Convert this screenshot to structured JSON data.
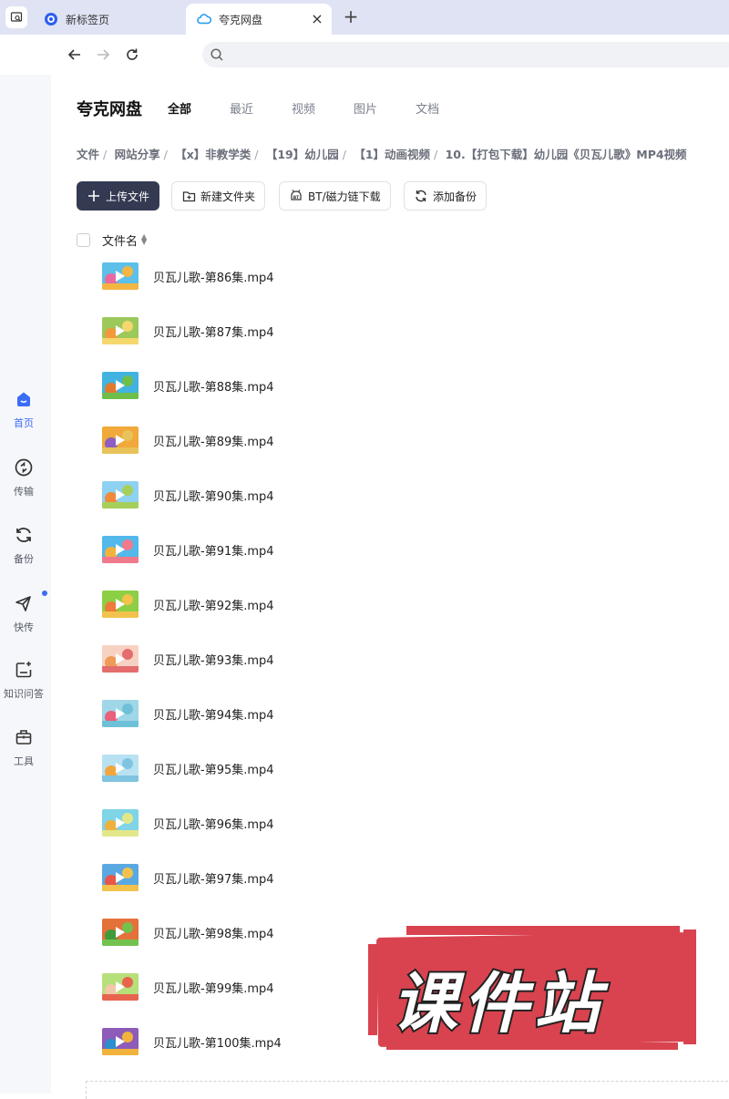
{
  "browser": {
    "tabs": [
      {
        "label": "新标签页",
        "active": false,
        "icon": "browser-logo-icon"
      },
      {
        "label": "夸克网盘",
        "active": true,
        "icon": "cloud-drive-icon"
      }
    ]
  },
  "rail": {
    "items": [
      {
        "label": "首页",
        "icon": "home-icon",
        "active": true
      },
      {
        "label": "传输",
        "icon": "transfer-icon",
        "active": false
      },
      {
        "label": "备份",
        "icon": "backup-icon",
        "active": false
      },
      {
        "label": "快传",
        "icon": "quick-send-icon",
        "active": false,
        "badge": true
      },
      {
        "label": "知识问答",
        "icon": "knowledge-qa-icon",
        "active": false
      },
      {
        "label": "工具",
        "icon": "toolbox-icon",
        "active": false
      }
    ]
  },
  "header": {
    "title": "夸克网盘",
    "tabs": [
      {
        "label": "全部",
        "active": true
      },
      {
        "label": "最近",
        "active": false
      },
      {
        "label": "视频",
        "active": false
      },
      {
        "label": "图片",
        "active": false
      },
      {
        "label": "文档",
        "active": false
      }
    ]
  },
  "breadcrumb": [
    "文件",
    "网站分享",
    "【x】非教学类",
    "【19】幼儿园",
    "【1】动画视频",
    "10.【打包下载】幼儿园《贝瓦儿歌》MP4视频"
  ],
  "toolbar": {
    "upload": "上传文件",
    "new_folder": "新建文件夹",
    "bt_download": "BT/磁力链下载",
    "add_backup": "添加备份"
  },
  "list": {
    "column_name": "文件名",
    "files": [
      {
        "name": "贝瓦儿歌-第86集.mp4",
        "colors": [
          "#e86aa0",
          "#5cc0e8",
          "#f4b642"
        ]
      },
      {
        "name": "贝瓦儿歌-第87集.mp4",
        "colors": [
          "#f29a3b",
          "#9cc95a",
          "#f5d76e"
        ]
      },
      {
        "name": "贝瓦儿歌-第88集.mp4",
        "colors": [
          "#e07a2e",
          "#42b3e0",
          "#6dbf4a"
        ]
      },
      {
        "name": "贝瓦儿歌-第89集.mp4",
        "colors": [
          "#8c5fc0",
          "#f0a93a",
          "#e8c25a"
        ]
      },
      {
        "name": "贝瓦儿歌-第90集.mp4",
        "colors": [
          "#f08a3a",
          "#8fd1f0",
          "#a6cf5b"
        ]
      },
      {
        "name": "贝瓦儿歌-第91集.mp4",
        "colors": [
          "#f2b33d",
          "#53b8ea",
          "#f07a8c"
        ]
      },
      {
        "name": "贝瓦儿歌-第92集.mp4",
        "colors": [
          "#ee7b3a",
          "#8ccf45",
          "#f3c24c"
        ]
      },
      {
        "name": "贝瓦儿歌-第93集.mp4",
        "colors": [
          "#f09a58",
          "#f7d2c2",
          "#e46d6d"
        ]
      },
      {
        "name": "贝瓦儿歌-第94集.mp4",
        "colors": [
          "#e8607a",
          "#9fd6e8",
          "#6ec0d8"
        ]
      },
      {
        "name": "贝瓦儿歌-第95集.mp4",
        "colors": [
          "#f2a640",
          "#b8e2f2",
          "#7fc4e0"
        ]
      },
      {
        "name": "贝瓦儿歌-第96集.mp4",
        "colors": [
          "#f0b03e",
          "#7fd4e6",
          "#e2e88a"
        ]
      },
      {
        "name": "贝瓦儿歌-第97集.mp4",
        "colors": [
          "#e8564a",
          "#5aa8e2",
          "#f3c24c"
        ]
      },
      {
        "name": "贝瓦儿歌-第98集.mp4",
        "colors": [
          "#3f9a3a",
          "#e4713a",
          "#74c24e"
        ]
      },
      {
        "name": "贝瓦儿歌-第99集.mp4",
        "colors": [
          "#f0c8a8",
          "#b7df7a",
          "#e8644e"
        ]
      },
      {
        "name": "贝瓦儿歌-第100集.mp4",
        "colors": [
          "#2e8fd0",
          "#8e5bb8",
          "#f2b33d"
        ]
      }
    ]
  },
  "watermark": {
    "text": "课件站",
    "color": "#d9434f"
  }
}
